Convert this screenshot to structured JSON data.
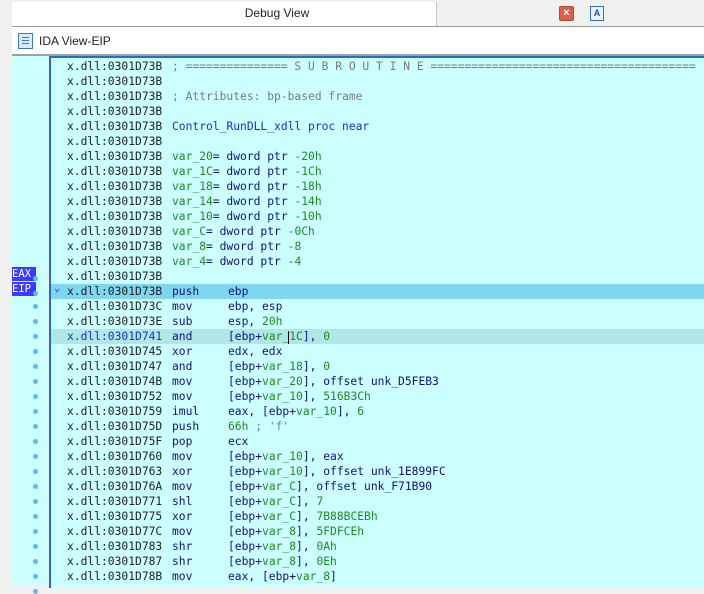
{
  "tabs": {
    "active_title": "Debug View",
    "close_icon": "close-icon",
    "inactive_icon": "structures-icon"
  },
  "view": {
    "title": "IDA View-EIP",
    "icon": "listing-view-icon"
  },
  "registers": [
    "EAX",
    "EIP"
  ],
  "header_lines": [
    {
      "addr": "x.dll:0301D73B",
      "text": "; =============== S U B R O U T I N E =======================================",
      "kind": "comment"
    },
    {
      "addr": "x.dll:0301D73B",
      "text": "",
      "kind": "plain"
    },
    {
      "addr": "x.dll:0301D73B",
      "text": "; Attributes: bp-based frame",
      "kind": "comment"
    },
    {
      "addr": "x.dll:0301D73B",
      "text": "",
      "kind": "plain"
    },
    {
      "addr": "x.dll:0301D73B",
      "text": "Control_RunDLL_xdll proc near",
      "kind": "name"
    },
    {
      "addr": "x.dll:0301D73B",
      "text": "",
      "kind": "plain"
    },
    {
      "addr": "x.dll:0301D73B",
      "var": "var_20",
      "decl": "= dword ptr ",
      "val": "-20h",
      "kind": "var"
    },
    {
      "addr": "x.dll:0301D73B",
      "var": "var_1C",
      "decl": "= dword ptr ",
      "val": "-1Ch",
      "kind": "var"
    },
    {
      "addr": "x.dll:0301D73B",
      "var": "var_18",
      "decl": "= dword ptr ",
      "val": "-18h",
      "kind": "var"
    },
    {
      "addr": "x.dll:0301D73B",
      "var": "var_14",
      "decl": "= dword ptr ",
      "val": "-14h",
      "kind": "var"
    },
    {
      "addr": "x.dll:0301D73B",
      "var": "var_10",
      "decl": "= dword ptr ",
      "val": "-10h",
      "kind": "var"
    },
    {
      "addr": "x.dll:0301D73B",
      "var": "var_C",
      "decl": "= dword ptr ",
      "val": "-0Ch",
      "kind": "var"
    },
    {
      "addr": "x.dll:0301D73B",
      "var": "var_8",
      "decl": "= dword ptr ",
      "val": "-8",
      "kind": "var"
    },
    {
      "addr": "x.dll:0301D73B",
      "var": "var_4",
      "decl": "= dword ptr ",
      "val": "-4",
      "kind": "var"
    },
    {
      "addr": "x.dll:0301D73B",
      "text": "",
      "kind": "plain"
    }
  ],
  "instructions": [
    {
      "addr": "x.dll:0301D73B",
      "mnem": "push",
      "ops": "ebp",
      "current": true
    },
    {
      "addr": "x.dll:0301D73C",
      "mnem": "mov",
      "ops": "ebp, esp"
    },
    {
      "addr": "x.dll:0301D73E",
      "mnem": "sub",
      "ops": "esp, 20h"
    },
    {
      "addr": "x.dll:0301D741",
      "mnem": "and",
      "ops": "[ebp+var_1C], 0",
      "selected": true
    },
    {
      "addr": "x.dll:0301D745",
      "mnem": "xor",
      "ops": "edx, edx"
    },
    {
      "addr": "x.dll:0301D747",
      "mnem": "and",
      "ops": "[ebp+var_18], 0"
    },
    {
      "addr": "x.dll:0301D74B",
      "mnem": "mov",
      "ops": "[ebp+var_20], offset unk_D5FEB3"
    },
    {
      "addr": "x.dll:0301D752",
      "mnem": "mov",
      "ops": "[ebp+var_10], 516B3Ch"
    },
    {
      "addr": "x.dll:0301D759",
      "mnem": "imul",
      "ops": "eax, [ebp+var_10], 6"
    },
    {
      "addr": "x.dll:0301D75D",
      "mnem": "push",
      "ops": "66h ; 'f'"
    },
    {
      "addr": "x.dll:0301D75F",
      "mnem": "pop",
      "ops": "ecx"
    },
    {
      "addr": "x.dll:0301D760",
      "mnem": "mov",
      "ops": "[ebp+var_10], eax"
    },
    {
      "addr": "x.dll:0301D763",
      "mnem": "xor",
      "ops": "[ebp+var_10], offset unk_1E899FC"
    },
    {
      "addr": "x.dll:0301D76A",
      "mnem": "mov",
      "ops": "[ebp+var_C], offset unk_F71B90"
    },
    {
      "addr": "x.dll:0301D771",
      "mnem": "shl",
      "ops": "[ebp+var_C], 7"
    },
    {
      "addr": "x.dll:0301D775",
      "mnem": "xor",
      "ops": "[ebp+var_C], 7B88BCEBh"
    },
    {
      "addr": "x.dll:0301D77C",
      "mnem": "mov",
      "ops": "[ebp+var_8], 5FDFCEh"
    },
    {
      "addr": "x.dll:0301D783",
      "mnem": "shr",
      "ops": "[ebp+var_8], 0Ah"
    },
    {
      "addr": "x.dll:0301D787",
      "mnem": "shr",
      "ops": "[ebp+var_8], 0Eh"
    },
    {
      "addr": "x.dll:0301D78B",
      "mnem": "mov",
      "ops": "eax, [ebp+var_8]"
    }
  ]
}
